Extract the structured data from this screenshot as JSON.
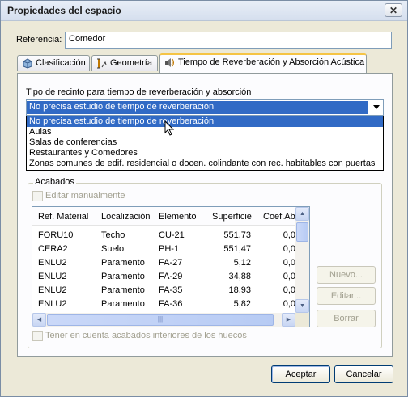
{
  "window": {
    "title": "Propiedades del espacio"
  },
  "referencia": {
    "label": "Referencia:",
    "value": "Comedor"
  },
  "tabs": [
    {
      "label": "Clasificación",
      "icon": "cube-icon"
    },
    {
      "label": "Geometría",
      "icon": "dimension-icon"
    },
    {
      "label": "Tiempo de Reverberación y Absorción Acústica",
      "icon": "speaker-icon"
    }
  ],
  "reverb": {
    "label": "Tipo de recinto para tiempo de reverberación y absorción",
    "selected": "No precisa estudio de tiempo de reverberación",
    "options": [
      "No precisa estudio de tiempo de reverberación",
      "Aulas",
      "Salas de conferencias",
      "Restaurantes y Comedores",
      "Zonas comunes de edif. residencial o docen. colindante con rec. habitables con puertas"
    ]
  },
  "acabados": {
    "title": "Acabados",
    "edit_manual": "Editar manualmente",
    "columns": [
      "Ref. Material",
      "Localización",
      "Elemento",
      "Superficie",
      "Coef.Ab"
    ],
    "rows": [
      [
        "FORU10",
        "Techo",
        "CU-21",
        "551,73",
        "0,0"
      ],
      [
        "CERA2",
        "Suelo",
        "PH-1",
        "551,47",
        "0,0"
      ],
      [
        "ENLU2",
        "Paramento",
        "FA-27",
        "5,12",
        "0,0"
      ],
      [
        "ENLU2",
        "Paramento",
        "FA-29",
        "34,88",
        "0,0"
      ],
      [
        "ENLU2",
        "Paramento",
        "FA-35",
        "18,93",
        "0,0"
      ],
      [
        "ENLU2",
        "Paramento",
        "FA-36",
        "5,82",
        "0,0"
      ]
    ],
    "buttons": {
      "nuevo": "Nuevo...",
      "editar": "Editar...",
      "borrar": "Borrar"
    },
    "huecos": "Tener en cuenta acabados interiores de los huecos"
  },
  "footer": {
    "accept": "Aceptar",
    "cancel": "Cancelar"
  },
  "colors": {
    "selection": "#316ac5",
    "tab_highlight": "#f5c445"
  }
}
